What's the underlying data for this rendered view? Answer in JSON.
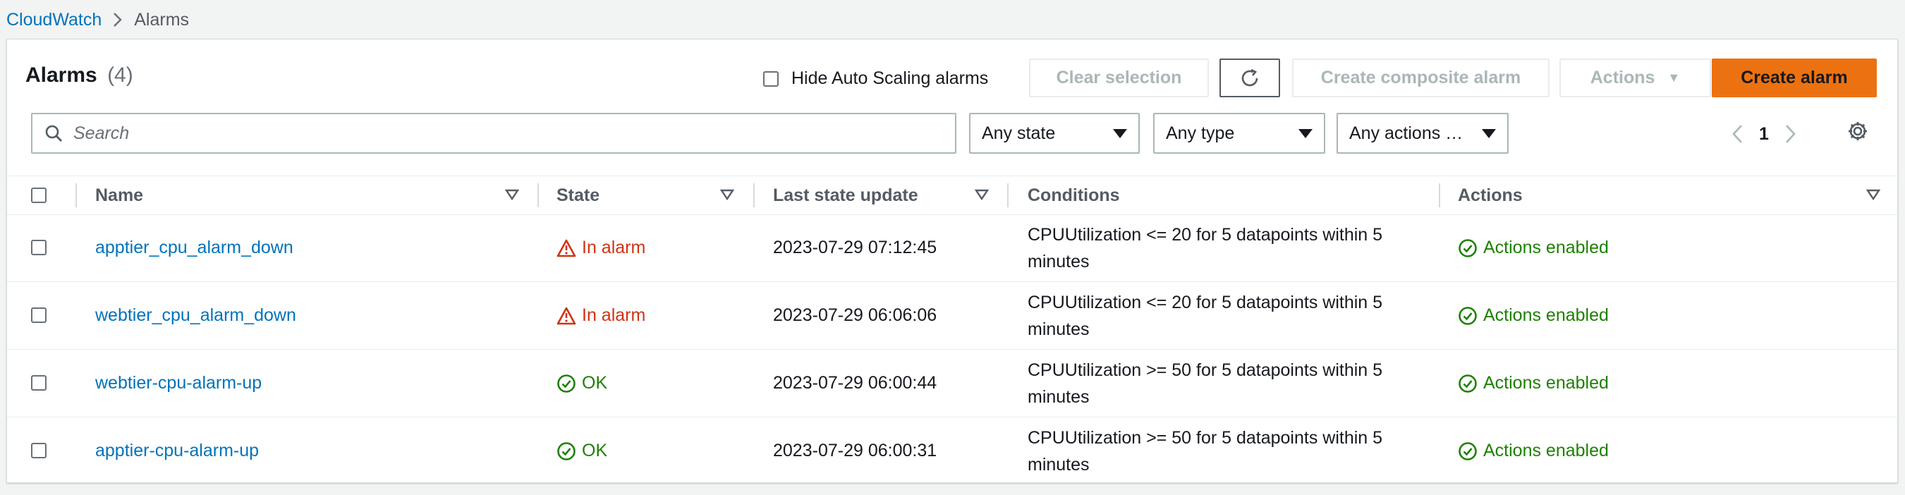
{
  "breadcrumb": {
    "root": "CloudWatch",
    "current": "Alarms"
  },
  "header": {
    "title": "Alarms",
    "count": "(4)",
    "hide_autoscaling_label": "Hide Auto Scaling alarms",
    "clear_selection_label": "Clear selection",
    "create_composite_label": "Create composite alarm",
    "actions_label": "Actions",
    "create_alarm_label": "Create alarm"
  },
  "filters": {
    "search_placeholder": "Search",
    "state": "Any state",
    "type": "Any type",
    "actions": "Any actions …"
  },
  "pagination": {
    "current_page": "1"
  },
  "table": {
    "columns": {
      "name": "Name",
      "state": "State",
      "last_update": "Last state update",
      "conditions": "Conditions",
      "actions": "Actions"
    },
    "rows": [
      {
        "name": "apptier_cpu_alarm_down",
        "state": "In alarm",
        "state_kind": "alarm",
        "updated": "2023-07-29 07:12:45",
        "condition_line1": "CPUUtilization <= 20 for 5 datapoints within 5",
        "condition_line2": "minutes",
        "actions": "Actions enabled"
      },
      {
        "name": "webtier_cpu_alarm_down",
        "state": "In alarm",
        "state_kind": "alarm",
        "updated": "2023-07-29 06:06:06",
        "condition_line1": "CPUUtilization <= 20 for 5 datapoints within 5",
        "condition_line2": "minutes",
        "actions": "Actions enabled"
      },
      {
        "name": "webtier-cpu-alarm-up",
        "state": "OK",
        "state_kind": "ok",
        "updated": "2023-07-29 06:00:44",
        "condition_line1": "CPUUtilization >= 50 for 5 datapoints within 5",
        "condition_line2": "minutes",
        "actions": "Actions enabled"
      },
      {
        "name": "apptier-cpu-alarm-up",
        "state": "OK",
        "state_kind": "ok",
        "updated": "2023-07-29 06:00:31",
        "condition_line1": "CPUUtilization >= 50 for 5 datapoints within 5",
        "condition_line2": "minutes",
        "actions": "Actions enabled"
      }
    ]
  },
  "colors": {
    "link": "#0073bb",
    "alarm": "#d13212",
    "ok": "#1d8102",
    "primary": "#ec7211"
  }
}
